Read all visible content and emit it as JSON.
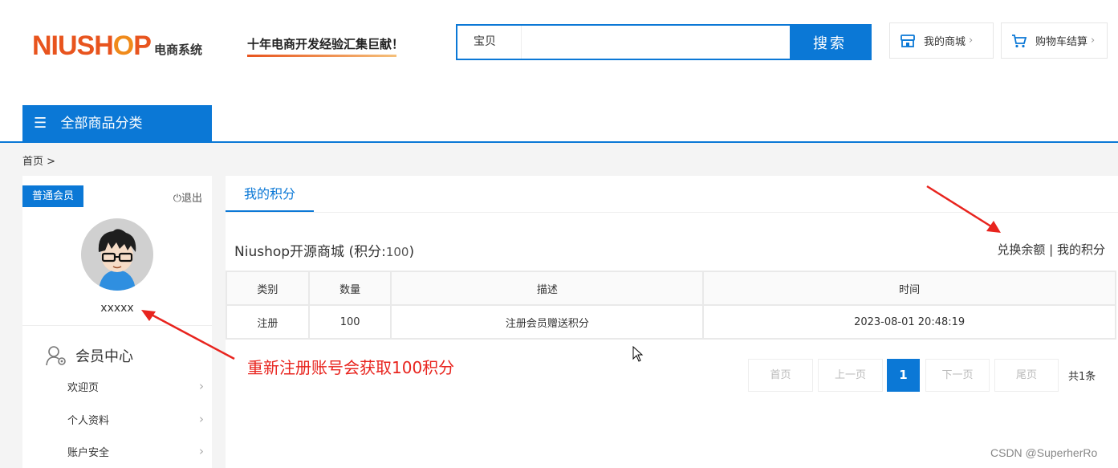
{
  "header": {
    "logo_main_a": "NIUSH",
    "logo_main_b": "O",
    "logo_main_c": "P",
    "logo_sub": "电商系统",
    "slogan": "十年电商开发经验汇集巨献！",
    "search": {
      "type": "宝贝",
      "placeholder": "",
      "button": "搜索"
    },
    "my_store": "我的商城",
    "cart": "购物车结算",
    "chevron": "›",
    "accent": "#0b78d6"
  },
  "nav": {
    "category_label": "全部商品分类",
    "burger": "☰"
  },
  "breadcrumb": "首页 >",
  "sidebar": {
    "badge": "普通会员",
    "logout": "⏻退出",
    "username": "xxxxx",
    "center_title": "会员中心",
    "items": [
      {
        "label": "欢迎页"
      },
      {
        "label": "个人资料"
      },
      {
        "label": "账户安全"
      }
    ]
  },
  "main": {
    "tab": "我的积分",
    "store_name": "Niushop开源商城 (积分:",
    "points": "100",
    "store_suffix": ")",
    "links": "兑换余额 | 我的积分",
    "table": {
      "headers": [
        "类别",
        "数量",
        "描述",
        "时间"
      ],
      "rows": [
        [
          "注册",
          "100",
          "注册会员赠送积分",
          "2023-08-01 20:48:19"
        ]
      ]
    },
    "pagination": {
      "first": "首页",
      "prev": "上一页",
      "current": "1",
      "next": "下一页",
      "last": "尾页",
      "total": "共1条"
    }
  },
  "annotation": "重新注册账号会获取100积分",
  "watermark": "CSDN @SuperherRo",
  "colors": {
    "annotation": "#e8241e",
    "primary": "#0b78d6"
  }
}
